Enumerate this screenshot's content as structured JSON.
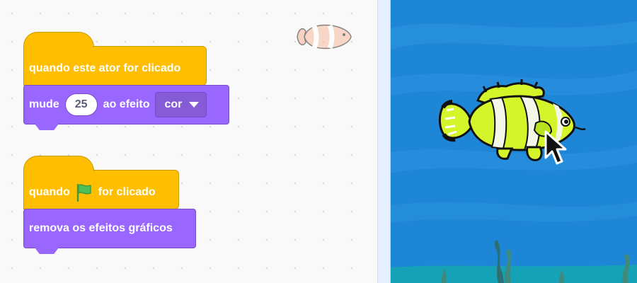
{
  "script1": {
    "hat_label": "quando este ator for clicado",
    "change_label": "mude",
    "change_value": "25",
    "effect_label": "ao efeito",
    "effect_option": "cor"
  },
  "script2": {
    "hat_prefix": "quando",
    "hat_suffix": "for clicado",
    "clear_label": "remova os efeitos gráficos"
  },
  "icons": [
    "sprite-thumbnail-fish",
    "green-flag-icon",
    "dropdown-caret-icon",
    "mouse-pointer-icon"
  ],
  "colors": {
    "events_block": "#ffbf00",
    "looks_block": "#9966ff",
    "stage_water": "#1e86d6",
    "fish": "#d4f52a"
  }
}
